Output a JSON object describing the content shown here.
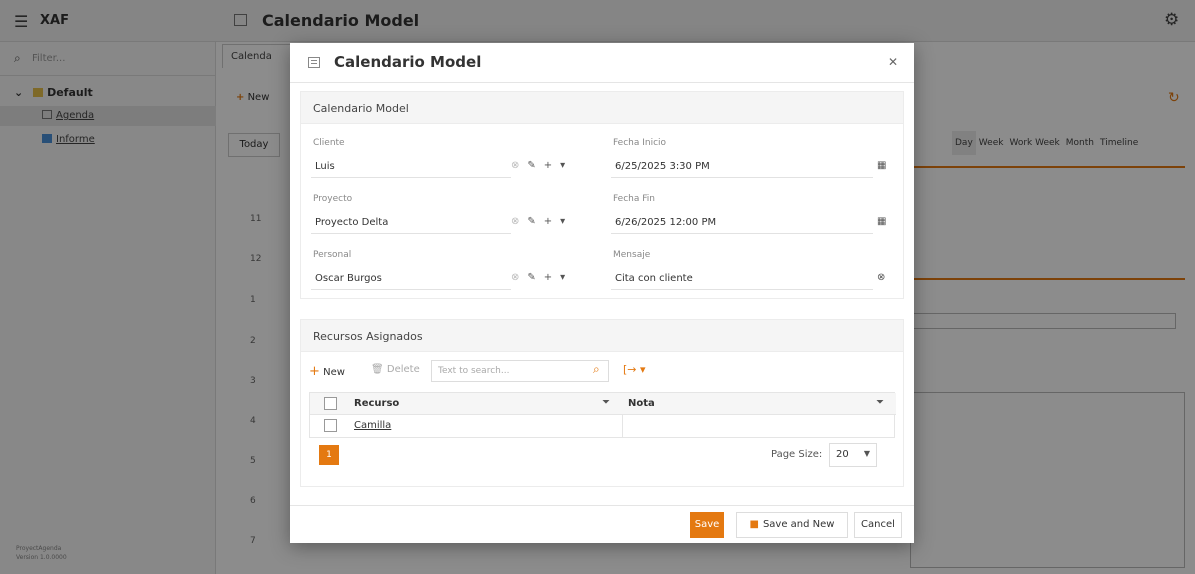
{
  "app": {
    "name": "XAF",
    "page_title": "Calendario Model",
    "filter_placeholder": "Filter...",
    "nav": {
      "group": "Default",
      "items": [
        {
          "label": "Agenda"
        },
        {
          "label": "Informe"
        }
      ]
    },
    "version": [
      "ProyectAgenda",
      "Version 1.0.0000"
    ],
    "tab_label": "Calenda",
    "new_label": "New",
    "today_label": "Today",
    "views": [
      "Day",
      "Week",
      "Work Week",
      "Month",
      "Timeline"
    ],
    "time_rows": [
      "11",
      "12",
      "1",
      "2",
      "3",
      "4",
      "5",
      "6",
      "7"
    ]
  },
  "modal": {
    "title": "Calendario Model",
    "detail_section": {
      "title": "Calendario Model",
      "fields": {
        "cliente": {
          "label": "Cliente",
          "value": "Luis"
        },
        "proyecto": {
          "label": "Proyecto",
          "value": "Proyecto Delta"
        },
        "personal": {
          "label": "Personal",
          "value": "Oscar Burgos"
        },
        "fecha_inicio": {
          "label": "Fecha Inicio",
          "value": "6/25/2025 3:30 PM"
        },
        "fecha_fin": {
          "label": "Fecha Fin",
          "value": "6/26/2025 12:00 PM"
        },
        "mensaje": {
          "label": "Mensaje",
          "value": "Cita con cliente"
        }
      }
    },
    "recursos_section": {
      "title": "Recursos Asignados",
      "toolbar": {
        "new_label": "New",
        "delete_label": "Delete",
        "search_placeholder": "Text to search..."
      },
      "columns": [
        "Recurso",
        "Nota"
      ],
      "rows": [
        {
          "recurso": "Camilla",
          "nota": ""
        }
      ],
      "pager": {
        "current_page": "1",
        "page_size_label": "Page Size:",
        "page_size": "20"
      }
    },
    "footer": {
      "save_label": "Save",
      "save_new_label": "Save and New",
      "cancel_label": "Cancel"
    }
  },
  "colors": {
    "accent": "#e47911",
    "overlay": "rgba(0,0,0,0.45)"
  },
  "icons": [
    "hamburger-icon",
    "settings-icon",
    "search-icon",
    "folder-icon",
    "calendar-icon",
    "close-icon",
    "pencil-icon",
    "plus-icon",
    "chevron-down-icon",
    "clear-icon",
    "filter-icon",
    "export-icon",
    "refresh-icon",
    "save-icon"
  ]
}
